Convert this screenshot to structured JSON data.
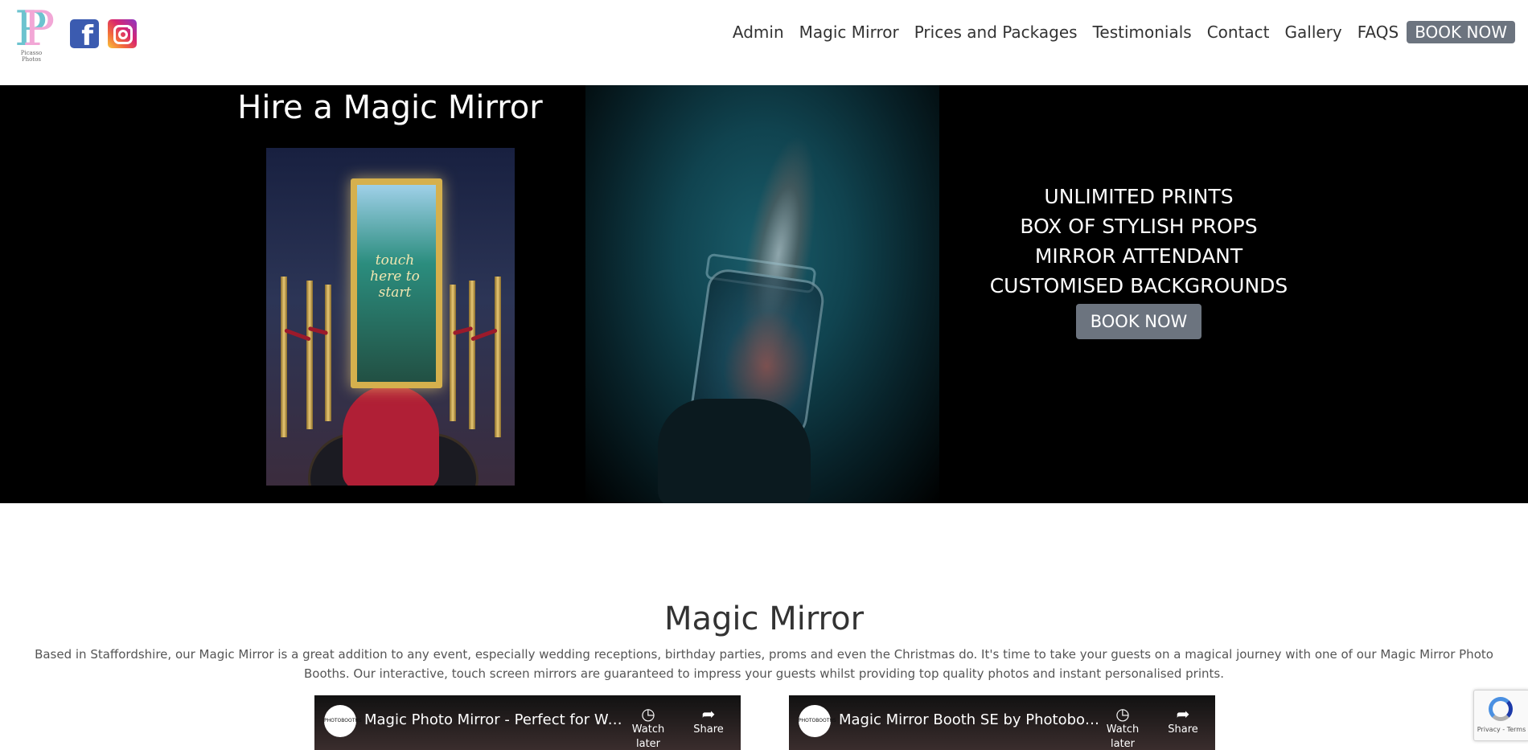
{
  "header": {
    "logo": {
      "letters": "P",
      "caption": "Picasso Photos"
    },
    "social": [
      {
        "name": "facebook",
        "glyph": "f"
      },
      {
        "name": "instagram"
      }
    ],
    "nav": [
      {
        "label": "Admin"
      },
      {
        "label": "Magic Mirror"
      },
      {
        "label": "Prices and Packages"
      },
      {
        "label": "Testimonials"
      },
      {
        "label": "Contact"
      },
      {
        "label": "Gallery"
      },
      {
        "label": "FAQS"
      },
      {
        "label": "BOOK NOW"
      }
    ]
  },
  "hero": {
    "title": "Hire a Magic Mirror",
    "mirror_text": "touch here to start",
    "features": [
      "UNLIMITED PRINTS",
      "BOX OF STYLISH PROPS",
      "MIRROR ATTENDANT",
      "CUSTOMISED BACKGROUNDS"
    ],
    "book_label": "BOOK NOW"
  },
  "content": {
    "title": "Magic Mirror",
    "intro": "Based in Staffordshire, our Magic Mirror is a great addition to any event, especially wedding receptions, birthday parties, proms and even the Christmas do. It's time to take your guests on a magical journey with one of our Magic Mirror Photo Booths. Our interactive, touch screen mirrors are guaranteed to impress your guests whilst providing top quality photos and instant personalised prints.",
    "videos": [
      {
        "title": "Magic Photo Mirror - Perfect for Wed...",
        "channel": "PHOTOBOOTHS",
        "watch_later": "Watch later",
        "share": "Share"
      },
      {
        "title": "Magic Mirror Booth SE by Photoboot...",
        "channel": "PHOTOBOOTHS",
        "watch_later": "Watch later",
        "share": "Share"
      }
    ]
  },
  "recaptcha": {
    "text": "Privacy - Terms"
  },
  "colors": {
    "button_gray": "#6c747f",
    "facebook": "#3b5bb0",
    "hero_bg": "#000000"
  }
}
